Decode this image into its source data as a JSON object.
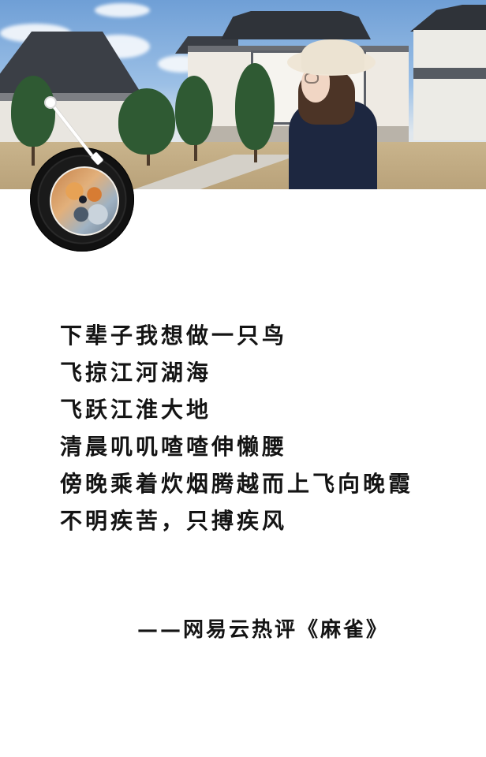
{
  "poem": {
    "lines": [
      "下辈子我想做一只鸟",
      "飞掠江河湖海",
      "飞跃江淮大地",
      "清晨叽叽喳喳伸懒腰",
      "傍晚乘着炊烟腾越而上飞向晚霞",
      "不明疾苦，只搏疾风"
    ],
    "attribution": "——网易云热评《麻雀》"
  },
  "icons": {
    "record": "vinyl-record-icon",
    "tonearm": "tonearm-icon"
  },
  "colors": {
    "text": "#141414",
    "background": "#ffffff",
    "record": "#111111"
  }
}
